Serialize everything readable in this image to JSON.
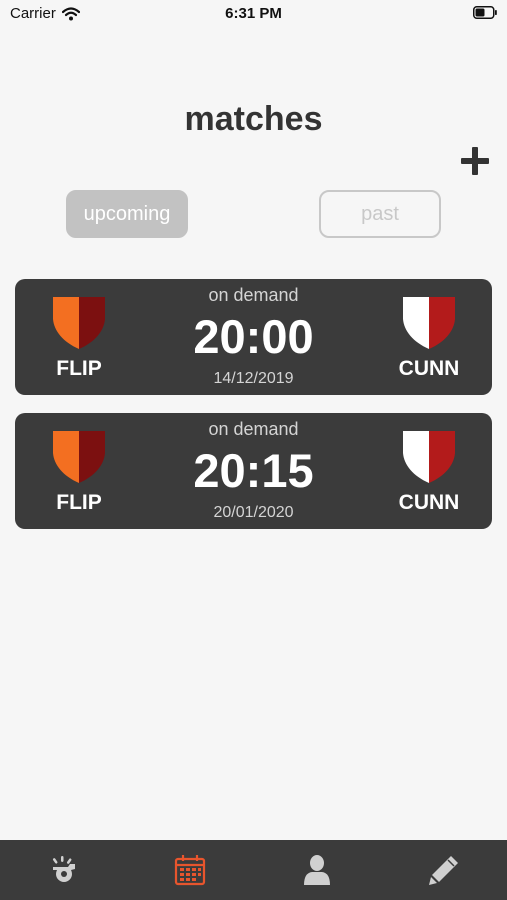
{
  "status_bar": {
    "carrier": "Carrier",
    "time": "6:31 PM"
  },
  "header": {
    "title": "matches",
    "add_icon": "plus-icon"
  },
  "segments": {
    "upcoming_label": "upcoming",
    "past_label": "past",
    "selected": "upcoming"
  },
  "matches": [
    {
      "mode": "on demand",
      "time": "20:00",
      "date": "14/12/2019",
      "home_team": "FLIP",
      "away_team": "CUNN"
    },
    {
      "mode": "on demand",
      "time": "20:15",
      "date": "20/01/2020",
      "home_team": "FLIP",
      "away_team": "CUNN"
    }
  ],
  "tab_bar": {
    "tabs": [
      {
        "icon": "whistle-icon",
        "active": false
      },
      {
        "icon": "calendar-icon",
        "active": true
      },
      {
        "icon": "user-icon",
        "active": false
      },
      {
        "icon": "pencil-icon",
        "active": false
      }
    ]
  },
  "colors": {
    "background": "#f6f6f6",
    "card": "#3b3b3b",
    "tab_active": "#e8552d",
    "tab_inactive": "#d0d0d0",
    "home_shield_left": "#f36f21",
    "home_shield_right": "#7c1010",
    "away_shield_left": "#ffffff",
    "away_shield_right": "#b31b1b"
  }
}
